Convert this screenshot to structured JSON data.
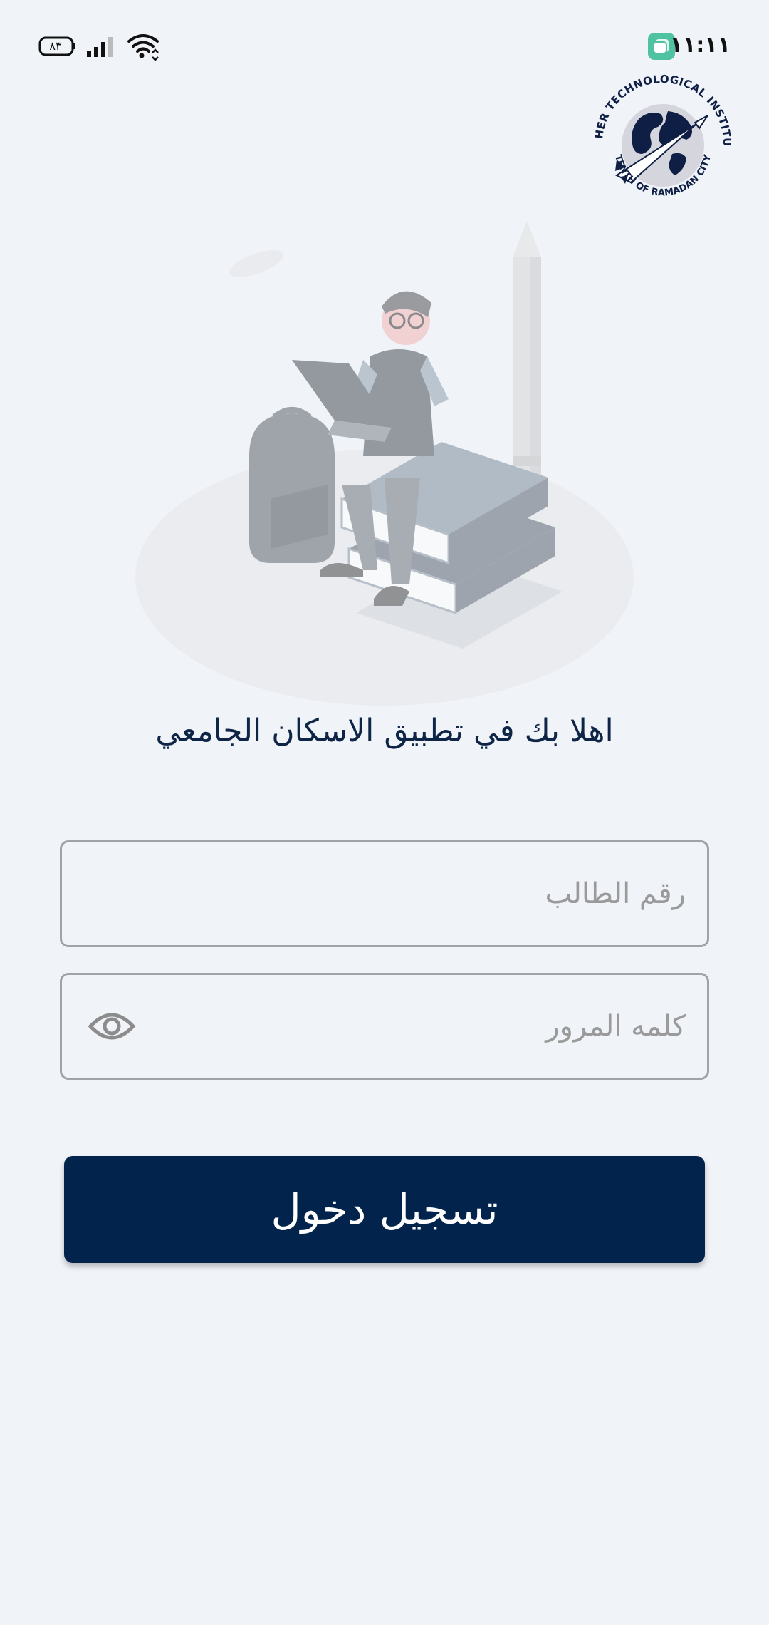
{
  "status_bar": {
    "time": "١١:١١",
    "battery": "٨٣",
    "icons": [
      "notification-app-icon",
      "battery-icon",
      "signal-icon",
      "wifi-icon"
    ]
  },
  "logo": {
    "top_text": "HIGHER TECHNOLOGICAL INSTITUTE",
    "bottom_text": "TENTH OF RAMADAN CITY"
  },
  "welcome_text": "اهلا بك في تطبيق الاسكان الجامعي",
  "form": {
    "student_id_placeholder": "رقم الطالب",
    "student_id_value": "",
    "password_placeholder": "كلمه المرور",
    "password_value": "",
    "password_toggle_icon": "eye-icon"
  },
  "login_button_label": "تسجيل دخول",
  "colors": {
    "background": "#f0f3f8",
    "primary": "#02244c",
    "title": "#0e2547",
    "field_border": "#9ea3a8",
    "placeholder": "#9a9a9a"
  }
}
